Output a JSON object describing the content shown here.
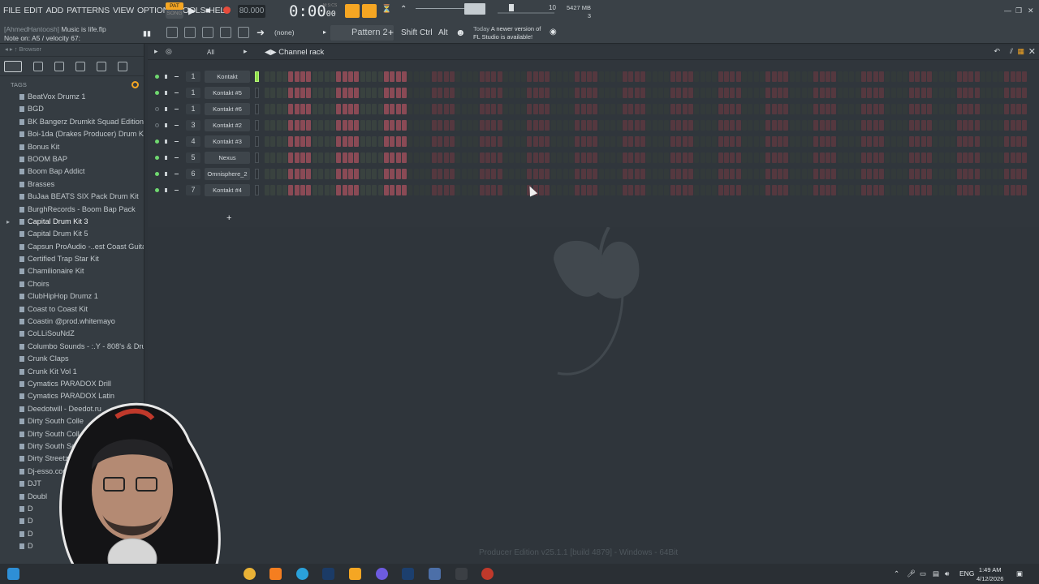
{
  "menu": [
    "FILE",
    "EDIT",
    "ADD",
    "PATTERNS",
    "VIEW",
    "OPTIONS",
    "TOOLS",
    "HELP"
  ],
  "info": {
    "user": "[AhmedHantoosh]",
    "project": "Music is life.flp",
    "note": "Note on: A5 / velocity 67:"
  },
  "transport": {
    "pat": "PAT",
    "song": "SONG",
    "tempo": "80.000",
    "time_main": "0:00",
    "time_sub": "00",
    "mscs": "M:S:CS"
  },
  "meters": {
    "cpu_count": "10",
    "memory": "5427 MB",
    "voices": "3"
  },
  "toolbar": {
    "channel_selector": "(none)",
    "pattern": "Pattern 2",
    "shift": "Shift",
    "ctrl": "Ctrl",
    "alt": "Alt"
  },
  "news": {
    "day": "Today",
    "line1": "A newer version of",
    "line2": "FL Studio is available!"
  },
  "browser": {
    "title": "Browser",
    "tags": "TAGS",
    "items": [
      "BeatVox Drumz 1",
      "BGD",
      "BK Bangerz Drumkit Squad Edition",
      "Boi-1da (Drakes Producer) Drum Kit",
      "Bonus Kit",
      "BOOM BAP",
      "Boom Bap Addict",
      "Brasses",
      "BuJaa BEATS SIX Pack Drum Kit",
      "BurghRecords - Boom Bap Pack",
      "Capital Drum Kit 3",
      "Capital Drum Kit 5",
      "Capsun ProAudio -..est Coast Guitars",
      "Certified Trap Star Kit",
      "Chamilionaire Kit",
      "Choirs",
      "ClubHipHop Drumz 1",
      "Coast to Coast Kit",
      "Coastin @prod.whitemayo",
      "CoLLiSouNdZ",
      "Columbo Sounds - :.Y - 808's & Drums",
      "Crunk Claps",
      "Crunk Kit Vol 1",
      "Cymatics PARADOX Drill",
      "Cymatics PARADOX Latin",
      "Deedotwill - Deedot.ru",
      "Dirty South Colle",
      "Dirty South Coll",
      "Dirty South So",
      "Dirty Streetz",
      "Dj-esso.com",
      "DJT",
      "Doubl",
      "D",
      "D",
      "D",
      "D"
    ],
    "selected": "Capital Drum Kit 3"
  },
  "rack": {
    "filter": "All",
    "title": "Channel rack",
    "channels": [
      {
        "mixer": "1",
        "name": "Kontakt",
        "on": true
      },
      {
        "mixer": "1",
        "name": "Kontakt #5",
        "on": true
      },
      {
        "mixer": "1",
        "name": "Kontakt #6",
        "on": false
      },
      {
        "mixer": "3",
        "name": "Kontakt #2",
        "on": false
      },
      {
        "mixer": "4",
        "name": "Kontakt #3",
        "on": true
      },
      {
        "mixer": "5",
        "name": "Nexus",
        "on": true
      },
      {
        "mixer": "6",
        "name": "Omnisphere_2",
        "on": true
      },
      {
        "mixer": "7",
        "name": "Kontakt #4",
        "on": true
      }
    ]
  },
  "footer_text": "Producer Edition v25.1.1 [build 4879] - Windows - 64Bit",
  "taskbar": {
    "lang": "ENG",
    "time": "1:49 AM",
    "date": "4/12/2026"
  },
  "colors": {
    "accent": "#f5a623",
    "step_red": "#8a4a55",
    "step_grey": "#39423f",
    "led_on": "#6fd86f"
  }
}
